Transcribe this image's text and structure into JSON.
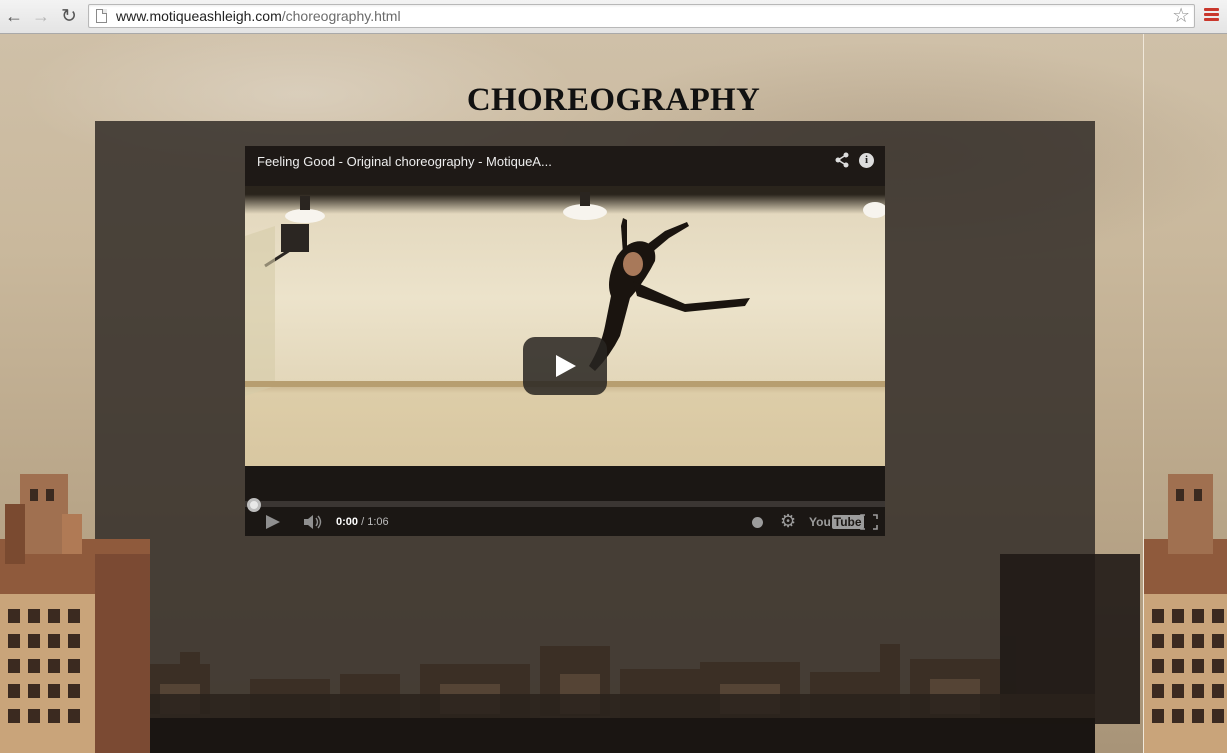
{
  "browser": {
    "url_host": "www.motiqueashleigh.com",
    "url_path": "/choreography.html"
  },
  "page": {
    "title": "CHOREOGRAPHY"
  },
  "video": {
    "title": "Feeling Good - Original choreography - MotiqueA...",
    "current_time": "0:00",
    "duration": " / 1:06",
    "progress": 0,
    "brand": "You",
    "brand_box": "Tube"
  },
  "icons": {
    "back": "back-arrow-icon",
    "forward": "forward-arrow-icon",
    "reload": "reload-icon",
    "bookmark": "star-icon",
    "menu": "hamburger-menu-icon",
    "share": "share-icon",
    "info": "info-icon",
    "play": "play-icon",
    "volume": "volume-icon",
    "watch_later": "clock-icon",
    "settings": "gear-icon",
    "fullscreen": "fullscreen-icon"
  }
}
